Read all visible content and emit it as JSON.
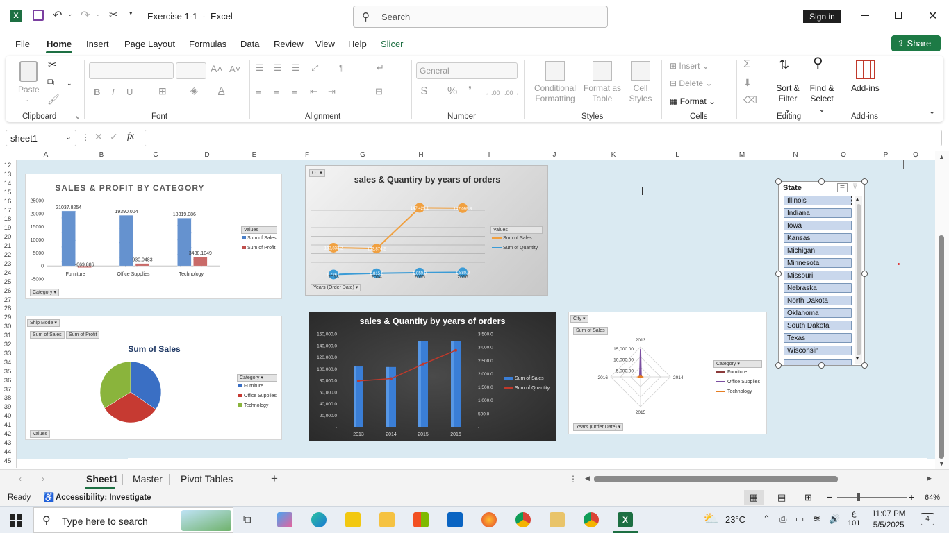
{
  "titlebar": {
    "doc_title": "Exercise 1-1  -  Excel",
    "search_placeholder": "Search",
    "signin": "Sign in"
  },
  "menu": {
    "items": [
      "File",
      "Home",
      "Insert",
      "Page Layout",
      "Formulas",
      "Data",
      "Review",
      "View",
      "Help",
      "Slicer"
    ],
    "active": "Home",
    "share": "Share"
  },
  "ribbon": {
    "groups": {
      "clipboard": "Clipboard",
      "font": "Font",
      "alignment": "Alignment",
      "number": "Number",
      "styles": "Styles",
      "cells": "Cells",
      "editing": "Editing",
      "addins": "Add-ins"
    },
    "paste": "Paste",
    "number_format": "General",
    "cond_format": [
      "Conditional",
      "Formatting"
    ],
    "format_table": [
      "Format as",
      "Table"
    ],
    "cell_styles": [
      "Cell",
      "Styles"
    ],
    "insert": "Insert",
    "delete": "Delete",
    "format": "Format",
    "sort_filter": [
      "Sort &",
      "Filter"
    ],
    "find_select": [
      "Find &",
      "Select"
    ],
    "addins": "Add-ins"
  },
  "formula_bar": {
    "name_box": "sheet1",
    "fx": "fx",
    "value": ""
  },
  "columns": [
    "A",
    "B",
    "C",
    "D",
    "E",
    "F",
    "G",
    "H",
    "I",
    "J",
    "K",
    "L",
    "M",
    "N",
    "O",
    "P",
    "Q"
  ],
  "rows": [
    "12",
    "13",
    "14",
    "15",
    "16",
    "17",
    "18",
    "19",
    "20",
    "21",
    "22",
    "23",
    "24",
    "25",
    "26",
    "27",
    "28",
    "29",
    "30",
    "31",
    "32",
    "33",
    "34",
    "35",
    "36",
    "37",
    "38",
    "39",
    "40",
    "41",
    "42",
    "43",
    "44",
    "45"
  ],
  "chart_data": [
    {
      "type": "bar",
      "title": "SALES & PROFIT BY CATEGORY",
      "categories": [
        "Furniture",
        "Office Supplies",
        "Technology"
      ],
      "series": [
        {
          "name": "Sum of Sales",
          "values": [
            21037.8254,
            19390.004,
            18319.086
          ],
          "labels": [
            "21037.8254",
            "19390.004",
            "18319.086"
          ]
        },
        {
          "name": "Sum of Profit",
          "values": [
            -669.886,
            930.0483,
            3438.1049
          ],
          "labels": [
            "-669.886",
            "930.0483",
            "3438.1049"
          ]
        }
      ],
      "yticks": [
        "25000",
        "20000",
        "15000",
        "10000",
        "5000",
        "0",
        "-5000"
      ],
      "ylim": [
        -5000,
        25000
      ],
      "legend_title": "Values",
      "field_button": "Category",
      "colors": {
        "Sum of Sales": "#4a7fc7",
        "Sum of Profit": "#c0504d"
      }
    },
    {
      "type": "line",
      "title": "sales & Quantiry by years of orders",
      "x": [
        "2013",
        "2014",
        "2015",
        "2016"
      ],
      "series": [
        {
          "name": "Sum of Sales",
          "values": [
            103833.2,
            102874.2,
            147429.1,
            147099.8
          ],
          "labels": [
            "103,833.2",
            "102,874.2",
            "147,429.1",
            "147,099.8"
          ]
        },
        {
          "name": "Sum of Quantity",
          "values": [
            1726.0,
            1815.0,
            1859.0,
            1880.0
          ],
          "labels": [
            "1,726.0",
            "1,815.0",
            "1,859.0",
            "1,880.0"
          ]
        }
      ],
      "legend_title": "Values",
      "field_button": "Years (Order Date)",
      "filter_button": "O..",
      "colors": {
        "Sum of Sales": "#f0a040",
        "Sum of Quantity": "#3a9bd6"
      }
    },
    {
      "type": "pie",
      "title": "Sum of Sales",
      "field_button": "Ship Mode",
      "value_buttons": [
        "Sum of Sales",
        "Sum of Profit"
      ],
      "legend_title": "Category",
      "bottom_button": "Values",
      "categories": [
        "Furniture",
        "Office Supplies",
        "Technology"
      ],
      "values": [
        34.6,
        31.6,
        33.8
      ],
      "colors": [
        "#3a6fc4",
        "#c63a32",
        "#8ab43c"
      ]
    },
    {
      "type": "bar",
      "title": "sales & Quantity by years of orders",
      "x": [
        "2013",
        "2014",
        "2015",
        "2016"
      ],
      "series": [
        {
          "name": "Sum of Sales",
          "values": [
            103833.2,
            102874.2,
            147429.1,
            147099.8
          ]
        },
        {
          "name": "Sum of Quantity",
          "values": [
            1726,
            1815,
            2359,
            2880
          ]
        }
      ],
      "yticks_left": [
        "160,000.0",
        "140,000.0",
        "120,000.0",
        "100,000.0",
        "80,000.0",
        "60,000.0",
        "40,000.0",
        "20,000.0",
        "-"
      ],
      "yticks_right": [
        "3,500.0",
        "3,000.0",
        "2,500.0",
        "2,000.0",
        "1,500.0",
        "1,000.0",
        "500.0",
        "-"
      ],
      "ylim": [
        0,
        160000
      ],
      "ylim_right": [
        0,
        3500
      ],
      "colors": {
        "Sum of Sales": "#3a7ed6",
        "Sum of Quantity": "#c0392b"
      }
    },
    {
      "type": "radar",
      "field_button": "City",
      "value_button": "Sum of Sales",
      "axes": [
        "2013",
        "2014",
        "2015",
        "2016"
      ],
      "ticks": [
        "15,000.00",
        "10,000.00",
        "5,000.00"
      ],
      "legend_title": "Category",
      "series": [
        {
          "name": "Furniture",
          "values": [
            1500,
            600,
            300,
            700
          ]
        },
        {
          "name": "Office Supplies",
          "values": [
            14000,
            300,
            200,
            400
          ]
        },
        {
          "name": "Technology",
          "values": [
            400,
            900,
            300,
            1100
          ]
        }
      ],
      "bottom_button": "Years (Order Date)",
      "colors": {
        "Furniture": "#8b3a3a",
        "Office Supplies": "#7b4fa0",
        "Technology": "#e67e22"
      }
    }
  ],
  "slicer": {
    "title": "State",
    "items": [
      "Illinois",
      "Indiana",
      "Iowa",
      "Kansas",
      "Michigan",
      "Minnesota",
      "Missouri",
      "Nebraska",
      "North Dakota",
      "Oklahoma",
      "South Dakota",
      "Texas",
      "Wisconsin"
    ]
  },
  "sheet_tabs": [
    "Sheet1",
    "Master",
    "Pivot Tables"
  ],
  "status": {
    "ready": "Ready",
    "accessibility": "Accessibility: Investigate",
    "zoom": "64%"
  },
  "taskbar": {
    "search": "Type here to search",
    "weather": "23°C",
    "lang": "ع",
    "lang_sub": "101",
    "time": "11:07 PM",
    "date": "5/5/2025",
    "notif": "4"
  }
}
